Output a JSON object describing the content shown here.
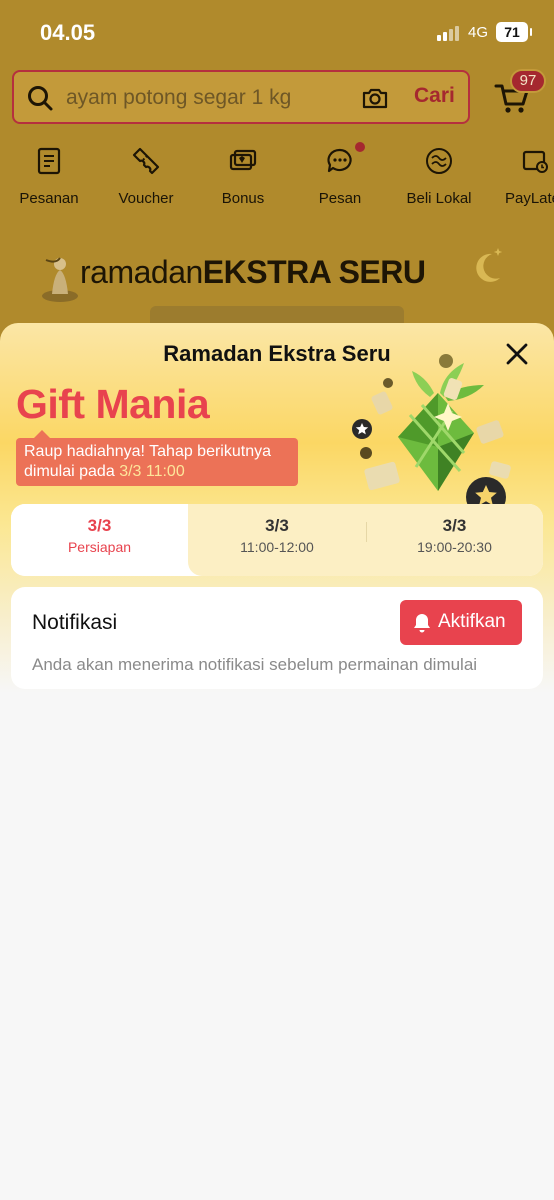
{
  "status_bar": {
    "time": "04.05",
    "network": "4G",
    "battery": "71"
  },
  "search": {
    "placeholder": "ayam potong segar 1 kg",
    "button_label": "Cari",
    "cart_count": "97"
  },
  "quick_menu": [
    {
      "label": "Pesanan",
      "icon": "orders-icon"
    },
    {
      "label": "Voucher",
      "icon": "voucher-icon"
    },
    {
      "label": "Bonus",
      "icon": "bonus-icon"
    },
    {
      "label": "Pesan",
      "icon": "message-icon"
    },
    {
      "label": "Beli Lokal",
      "icon": "beli-lokal-icon"
    },
    {
      "label": "PayLater",
      "icon": "paylater-icon"
    }
  ],
  "banner": {
    "title_thin": "ramadan",
    "title_bold": "EKSTRA SERU"
  },
  "sheet": {
    "title": "Ramadan Ekstra Seru",
    "gift_title": "Gift Mania",
    "gift_sub_line": "Raup hadiahnya! Tahap berikutnya dimulai pada",
    "gift_sub_date": "3/3 11:00",
    "tabs": [
      {
        "date": "3/3",
        "time": "Persiapan",
        "active": true
      },
      {
        "date": "3/3",
        "time": "11:00-12:00",
        "active": false
      },
      {
        "date": "3/3",
        "time": "19:00-20:30",
        "active": false
      }
    ],
    "notification": {
      "title": "Notifikasi",
      "button_label": "Aktifkan",
      "description": "Anda akan menerima notifikasi sebelum permainan dimulai"
    }
  },
  "colors": {
    "accent": "#e8434e",
    "banner_bg": "#b08a2c",
    "sheet_yellow": "#fbd764"
  }
}
